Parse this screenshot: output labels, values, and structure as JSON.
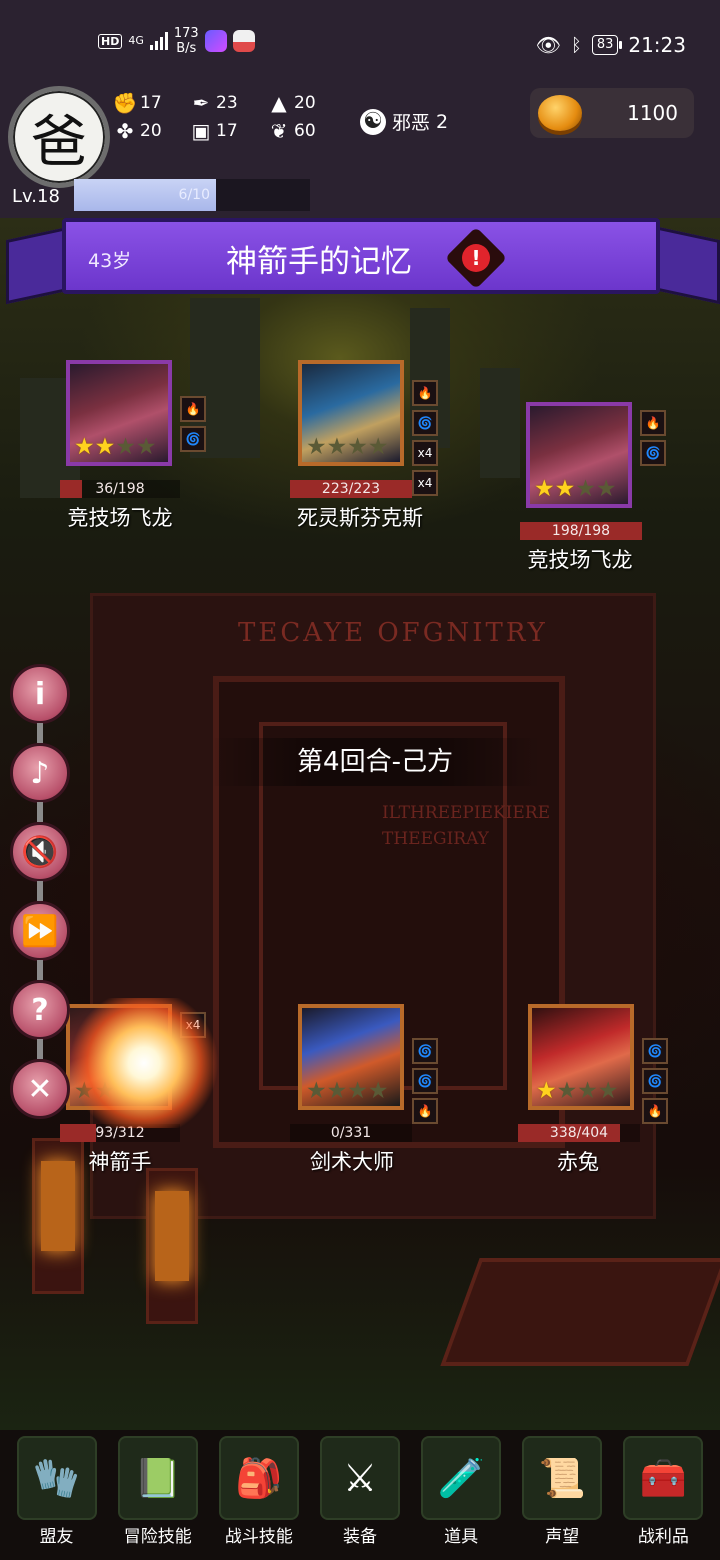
{
  "status_bar": {
    "network": "HD",
    "signal_type": "4G",
    "speed": "173",
    "speed_unit": "B/s",
    "battery": "83",
    "time": "21:23"
  },
  "hud": {
    "avatar_char": "爸",
    "stats": [
      {
        "icon": "fist-icon",
        "value": "17"
      },
      {
        "icon": "quill-icon",
        "value": "23"
      },
      {
        "icon": "wizard-hat-icon",
        "value": "20"
      },
      {
        "icon": "clover-icon",
        "value": "20"
      },
      {
        "icon": "armor-icon",
        "value": "17"
      },
      {
        "icon": "wings-icon",
        "value": "60"
      }
    ],
    "alignment": {
      "label": "邪恶",
      "value": "2"
    },
    "gold": "1100",
    "level": "Lv.18",
    "xp_text": "6/10",
    "xp_fraction": 0.6
  },
  "banner": {
    "age": "43岁",
    "title": "神箭手的记忆",
    "warning": "!"
  },
  "enemies": [
    {
      "name": "竞技场飞龙",
      "hp": "36/198",
      "hp_fraction": 0.18,
      "stars": 2,
      "frame": "purple",
      "skills": [
        "🔥",
        "🌀"
      ]
    },
    {
      "name": "死灵斯芬克斯",
      "hp": "223/223",
      "hp_fraction": 1.0,
      "stars": 0,
      "frame": "orange",
      "skills": [
        "🔥",
        "🌀",
        "x4",
        "x4"
      ]
    },
    {
      "name": "竞技场飞龙",
      "hp": "198/198",
      "hp_fraction": 1.0,
      "stars": 2,
      "frame": "purple",
      "skills": [
        "🔥",
        "🌀"
      ]
    }
  ],
  "allies": [
    {
      "name": "神箭手",
      "hp": "93/312",
      "hp_fraction": 0.3,
      "stars": 0,
      "frame": "orange",
      "skills": [
        "x4"
      ]
    },
    {
      "name": "剑术大师",
      "hp": "0/331",
      "hp_fraction": 0,
      "stars": 0,
      "frame": "orange",
      "skills": [
        "🌀",
        "🌀",
        "🔥"
      ]
    },
    {
      "name": "赤兔",
      "hp": "338/404",
      "hp_fraction": 0.84,
      "stars": 1,
      "frame": "orange",
      "skills": [
        "🌀",
        "🌀",
        "🔥"
      ]
    }
  ],
  "round_text": "第4回合-己方",
  "scene_text": {
    "gate_title": "TECAYE OFGNITRY",
    "gate_sub_1": "ILTHREEPIEKIERE",
    "gate_sub_2": "THEEGIRAY"
  },
  "side_buttons": [
    {
      "name": "info-button",
      "glyph": "i"
    },
    {
      "name": "music-off-button",
      "glyph": "♪"
    },
    {
      "name": "sound-off-button",
      "glyph": "🔇"
    },
    {
      "name": "fast-forward-button",
      "glyph": "⏩"
    },
    {
      "name": "help-button",
      "glyph": "?"
    },
    {
      "name": "close-button",
      "glyph": "✕"
    }
  ],
  "nav": [
    {
      "label": "盟友",
      "icon": "🧤"
    },
    {
      "label": "冒险技能",
      "icon": "📗"
    },
    {
      "label": "战斗技能",
      "icon": "🎒"
    },
    {
      "label": "装备",
      "icon": "⚔"
    },
    {
      "label": "道具",
      "icon": "🧪"
    },
    {
      "label": "声望",
      "icon": "📜"
    },
    {
      "label": "战利品",
      "icon": "🧰"
    }
  ],
  "colors": {
    "hud_bg": "#2b2230",
    "banner": "#7a44d8",
    "hp_bar": "#9a2a28",
    "star": "#ffd21e"
  }
}
